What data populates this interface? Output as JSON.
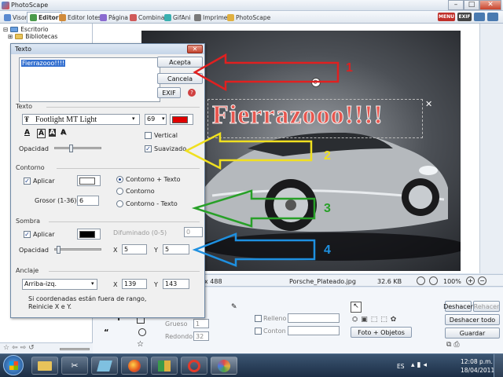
{
  "app": {
    "title": "PhotoScape"
  },
  "tabs": [
    {
      "label": "Visor"
    },
    {
      "label": "Editor"
    },
    {
      "label": "Editor lotes"
    },
    {
      "label": "Página"
    },
    {
      "label": "Combina"
    },
    {
      "label": "GifAni"
    },
    {
      "label": "Imprime"
    },
    {
      "label": "PhotoScape"
    }
  ],
  "badges": {
    "menu": "MENU",
    "exif": "EXIF"
  },
  "tree": {
    "item1": "Escritorio",
    "item2": "Bibliotecas"
  },
  "status": {
    "dims": "x 488",
    "filename": "Porsche_Plateado.jpg",
    "size": "32.6 KB",
    "zoom": "100%"
  },
  "bottom": {
    "grueso_label": "Grueso",
    "grueso_value": "1",
    "redondo_label": "Redondo",
    "redondo_value": "32",
    "relleno_label": "Relleno",
    "contorno_label": "Conton",
    "photo_objects": "Foto + Objetos",
    "undo": "Deshacer",
    "redo": "Rehacer",
    "undo_all": "Deshacer todo",
    "save": "Guardar"
  },
  "canvas": {
    "overlay_text": "Fierrazooo!!!!"
  },
  "dialog": {
    "title": "Texto",
    "text_value": "Fierrazooo!!!!",
    "buttons": {
      "accept": "Acepta",
      "cancel": "Cancela",
      "exif": "EXIF"
    },
    "text_section": {
      "header": "Texto",
      "font": "Footlight MT Light",
      "font_size": "69",
      "color": "#e00000",
      "vertical": "Vertical",
      "smooth": "Suavizado",
      "opacity": "Opacidad",
      "styles": [
        "A",
        "A",
        "A",
        "A"
      ]
    },
    "contour_section": {
      "header": "Contorno",
      "apply": "Aplicar",
      "thickness_label": "Grosor (1-36)",
      "thickness": "6",
      "color": "#ffffff",
      "options": [
        "Contorno + Texto",
        "Contorno",
        "Contorno - Texto"
      ]
    },
    "shadow_section": {
      "header": "Sombra",
      "apply": "Aplicar",
      "color": "#000000",
      "blur_label": "Difuminado (0-5)",
      "blur": "0",
      "opacity": "Opacidad",
      "x_label": "X",
      "x": "5",
      "y_label": "Y",
      "y": "5"
    },
    "anchor_section": {
      "header": "Anclaje",
      "value": "Arriba-izq.",
      "x_label": "X",
      "x": "139",
      "y_label": "Y",
      "y": "143",
      "note1": "Si coordenadas están fuera de rango,",
      "note2": "Reinicie X e Y."
    }
  },
  "annotations": {
    "n1": "1",
    "n2": "2",
    "n3": "3",
    "n4": "4"
  },
  "taskbar": {
    "lang": "ES",
    "time": "12:08 p.m.",
    "date": "18/04/2011"
  }
}
